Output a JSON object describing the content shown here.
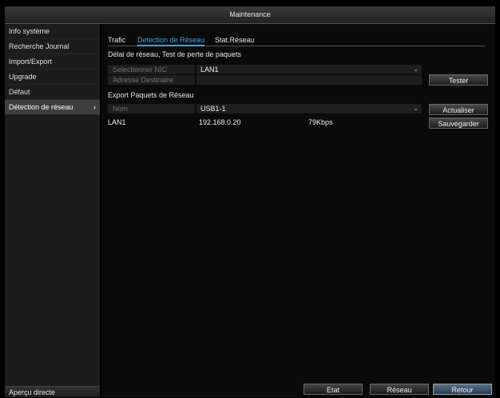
{
  "window": {
    "title": "Maintenance"
  },
  "sidebar": {
    "items": [
      {
        "label": "Info système"
      },
      {
        "label": "Recherche Journal"
      },
      {
        "label": "Import/Export"
      },
      {
        "label": "Upgrade"
      },
      {
        "label": "Défaut"
      },
      {
        "label": "Détection de réseau",
        "chevron": "›"
      }
    ],
    "bottom_label": "Aperçu directe"
  },
  "tabs": [
    {
      "label": "Trafic"
    },
    {
      "label": "Detection de Réseau"
    },
    {
      "label": "Stat.Réseau"
    }
  ],
  "delay_section": {
    "title": "Délai de réseau, Test de perte de paquets",
    "nic_label": "Selectionner NIC",
    "nic_value": "LAN1",
    "dest_label": "Adresse Destinaire",
    "dest_value": "",
    "test_button": "Tester"
  },
  "export_section": {
    "title": "Export Paquets de Réseau",
    "name_label": "Nom",
    "name_value": "USB1-1",
    "refresh_button": "Actualiser",
    "save_button": "Sauvegarder",
    "row": {
      "interface": "LAN1",
      "ip": "192.168.0.20",
      "rate": "79Kbps"
    }
  },
  "bottom_buttons": {
    "etat": "Etat",
    "reseau": "Réseau",
    "retour": "Retour"
  },
  "colors": {
    "accent": "#39a6e6",
    "background": "#000000"
  }
}
